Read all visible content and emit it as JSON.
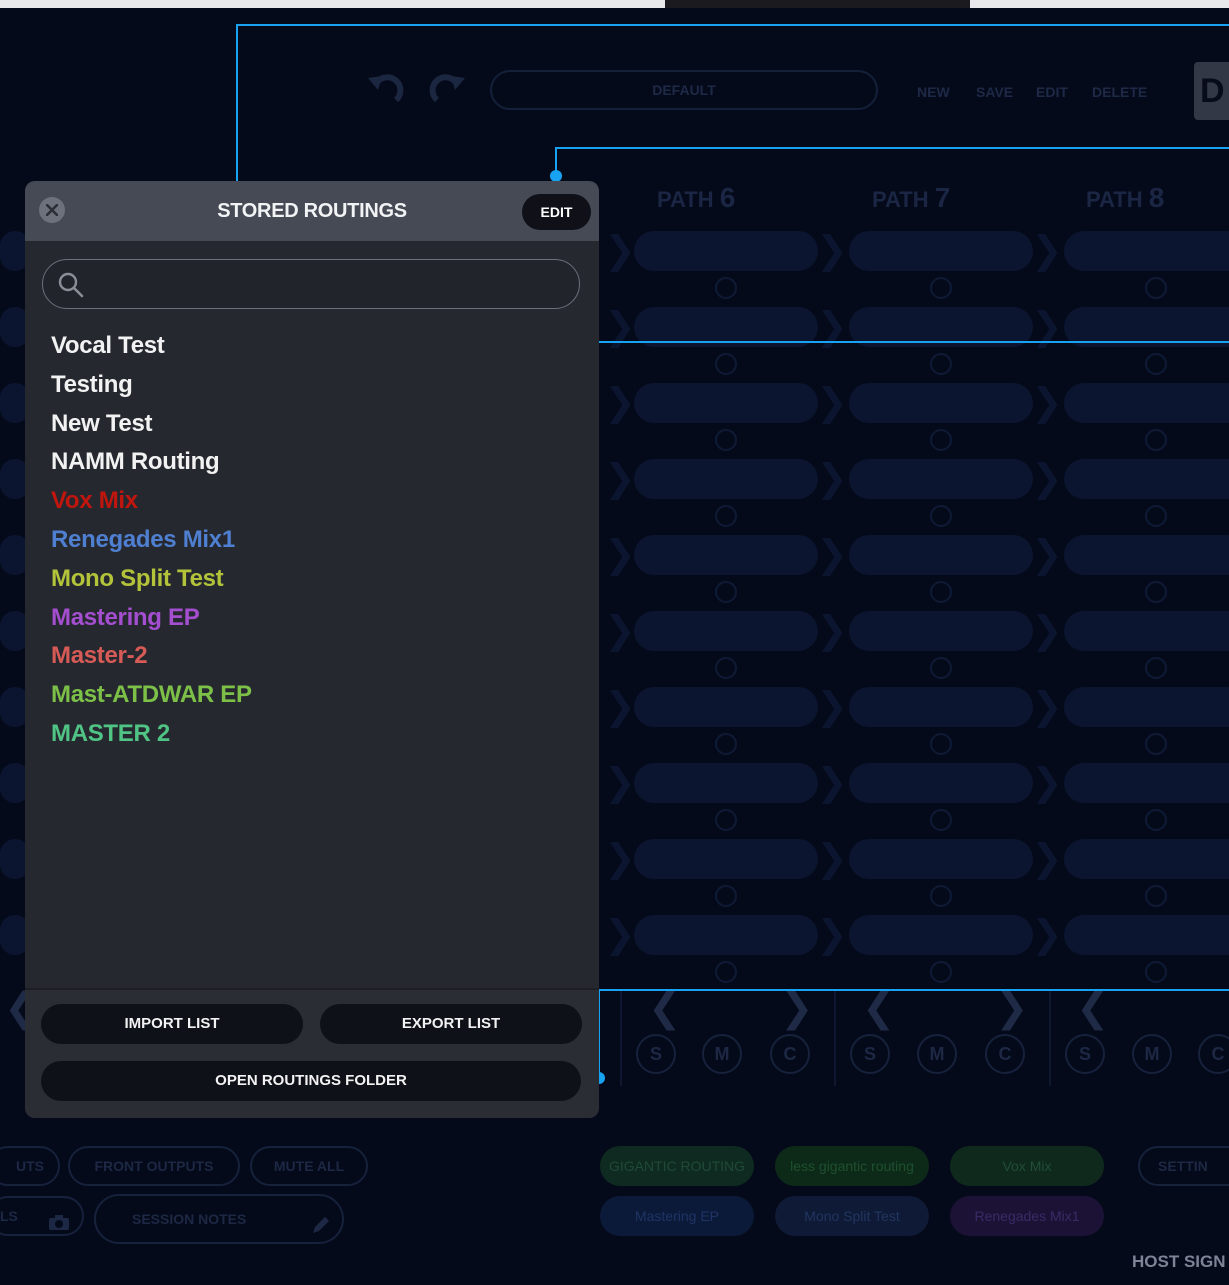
{
  "app": {
    "preset_name": "DEFAULT",
    "top_actions": [
      "NEW",
      "SAVE",
      "EDIT",
      "DELETE"
    ],
    "badge": "D",
    "path_label": "PATH",
    "paths": [
      "6",
      "7",
      "8"
    ],
    "smc": [
      "S",
      "M",
      "C"
    ],
    "bottom_left": {
      "outputs_partial": "UTS",
      "front_outputs": "FRONT OUTPUTS",
      "mute_all": "MUTE ALL",
      "ls_partial": "LS",
      "session_notes": "SESSION NOTES"
    },
    "quick_routings": [
      {
        "label": "GIGANTIC ROUTING",
        "bg": "#0f2a20",
        "color": "#1f4a38"
      },
      {
        "label": "less gigantic routing",
        "bg": "#0d2a18",
        "color": "#1e5030"
      },
      {
        "label": "Vox Mix",
        "bg": "#0f2a1c",
        "color": "#214d36"
      },
      {
        "label": "Mastering EP",
        "bg": "#0c1a3a",
        "color": "#1e3464"
      },
      {
        "label": "Mono Split Test",
        "bg": "#0e1a36",
        "color": "#223560"
      },
      {
        "label": "Renegades Mix1",
        "bg": "#1c1236",
        "color": "#3a2a66"
      }
    ],
    "settings_partial": "SETTIN",
    "host_signal": "HOST SIGN"
  },
  "modal": {
    "title": "STORED ROUTINGS",
    "edit_label": "EDIT",
    "search_placeholder": "",
    "routings": [
      {
        "name": "Vocal Test",
        "color": "#f2f2f2"
      },
      {
        "name": "Testing",
        "color": "#f2f2f2"
      },
      {
        "name": "New Test",
        "color": "#f2f2f2"
      },
      {
        "name": "NAMM Routing",
        "color": "#f2f2f2"
      },
      {
        "name": "Vox Mix",
        "color": "#c0160e"
      },
      {
        "name": "Renegades Mix1",
        "color": "#4f7fd0"
      },
      {
        "name": "Mono Split Test",
        "color": "#b3c43a"
      },
      {
        "name": "Mastering EP",
        "color": "#a44ed0"
      },
      {
        "name": "Master-2",
        "color": "#d65a56"
      },
      {
        "name": "Mast-ATDWAR EP",
        "color": "#7cc048"
      },
      {
        "name": "MASTER 2",
        "color": "#4fc484"
      }
    ],
    "import_label": "IMPORT LIST",
    "export_label": "EXPORT LIST",
    "open_folder_label": "OPEN ROUTINGS FOLDER"
  },
  "accent_color": "#17a2f2"
}
